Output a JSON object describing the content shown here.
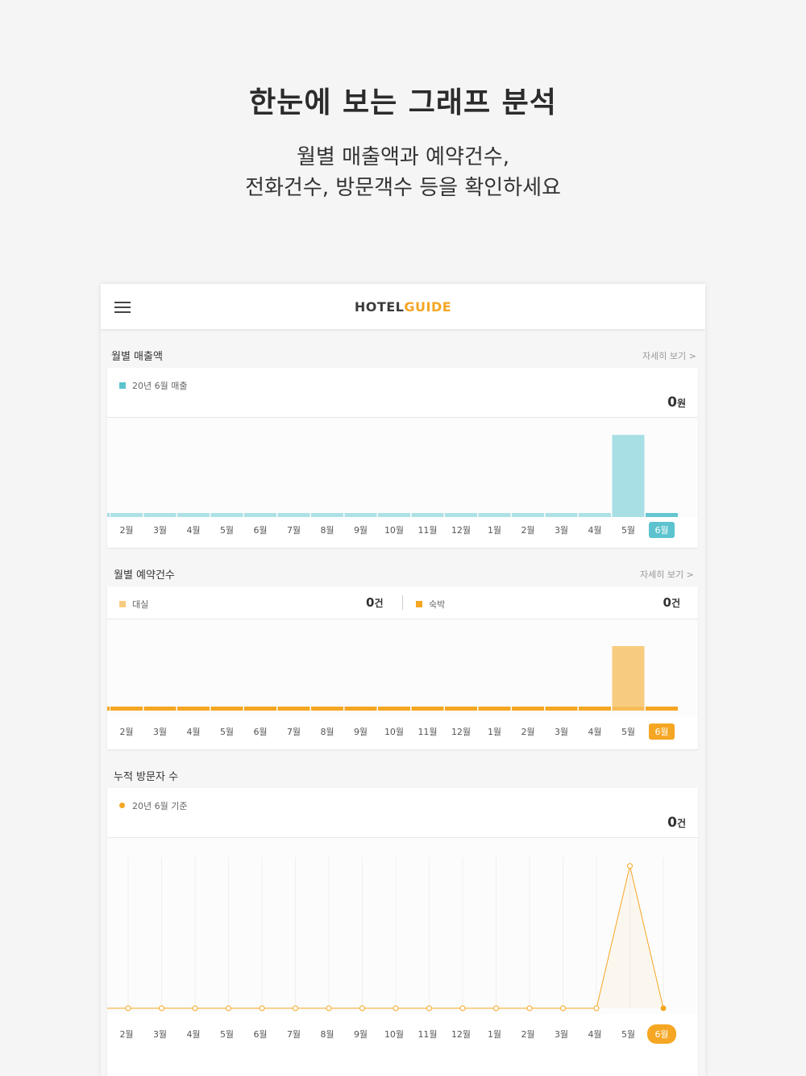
{
  "hero": {
    "title": "한눈에 보는 그래프 분석",
    "subtitle_line1": "월별 매출액과 예약건수,",
    "subtitle_line2": "전화건수, 방문객수 등을 확인하세요"
  },
  "appbar": {
    "logo_part1": "HOTEL",
    "logo_part2": "GUIDE",
    "menu_icon": "hamburger-icon"
  },
  "colors": {
    "teal": "#5cc3cf",
    "teal_light": "#a8dfe5",
    "orange": "#f5a623",
    "orange_light": "#f8cc80",
    "background": "#f5f5f5"
  },
  "months": [
    "2월",
    "3월",
    "4월",
    "5월",
    "6월",
    "7월",
    "8월",
    "9월",
    "10월",
    "11월",
    "12월",
    "1월",
    "2월",
    "3월",
    "4월",
    "5월",
    "6월"
  ],
  "sales": {
    "title": "월별 매출액",
    "more": "자세히 보기 >",
    "legend": "20년 6월 매출",
    "total_value": "0",
    "total_unit": "원"
  },
  "reservations": {
    "title": "월별 예약건수",
    "more": "자세히 보기 >",
    "legend_hall": "대실",
    "hall_value": "0",
    "hall_unit": "건",
    "legend_stay": "숙박",
    "stay_value": "0",
    "stay_unit": "건"
  },
  "visitors": {
    "title": "누적 방문자 수",
    "legend": "20년 6월 기준",
    "total_value": "0",
    "total_unit": "건"
  },
  "chart_data": [
    {
      "type": "bar",
      "categories": [
        "2월",
        "3월",
        "4월",
        "5월",
        "6월",
        "7월",
        "8월",
        "9월",
        "10월",
        "11월",
        "12월",
        "1월",
        "2월",
        "3월",
        "4월",
        "5월",
        "6월"
      ],
      "series": [
        {
          "name": "20년 6월 매출",
          "values": [
            0,
            0,
            0,
            0,
            0,
            0,
            0,
            0,
            0,
            0,
            0,
            0,
            0,
            0,
            0,
            100,
            0
          ]
        }
      ],
      "ylim": [
        0,
        110
      ],
      "highlight_index": 16
    },
    {
      "type": "bar",
      "categories": [
        "2월",
        "3월",
        "4월",
        "5월",
        "6월",
        "7월",
        "8월",
        "9월",
        "10월",
        "11월",
        "12월",
        "1월",
        "2월",
        "3월",
        "4월",
        "5월",
        "6월"
      ],
      "series": [
        {
          "name": "숙박",
          "values": [
            0,
            0,
            0,
            0,
            0,
            0,
            0,
            0,
            0,
            0,
            0,
            0,
            0,
            0,
            0,
            100,
            0
          ]
        }
      ],
      "ylim": [
        0,
        110
      ],
      "highlight_index": 16
    },
    {
      "type": "line",
      "categories": [
        "2월",
        "3월",
        "4월",
        "5월",
        "6월",
        "7월",
        "8월",
        "9월",
        "10월",
        "11월",
        "12월",
        "1월",
        "2월",
        "3월",
        "4월",
        "5월",
        "6월"
      ],
      "series": [
        {
          "name": "20년 6월 기준",
          "values": [
            0,
            0,
            0,
            0,
            0,
            0,
            0,
            0,
            0,
            0,
            0,
            0,
            0,
            0,
            0,
            100,
            0
          ]
        }
      ],
      "ylim": [
        0,
        106
      ],
      "grid": true,
      "highlight_index": 16
    }
  ]
}
